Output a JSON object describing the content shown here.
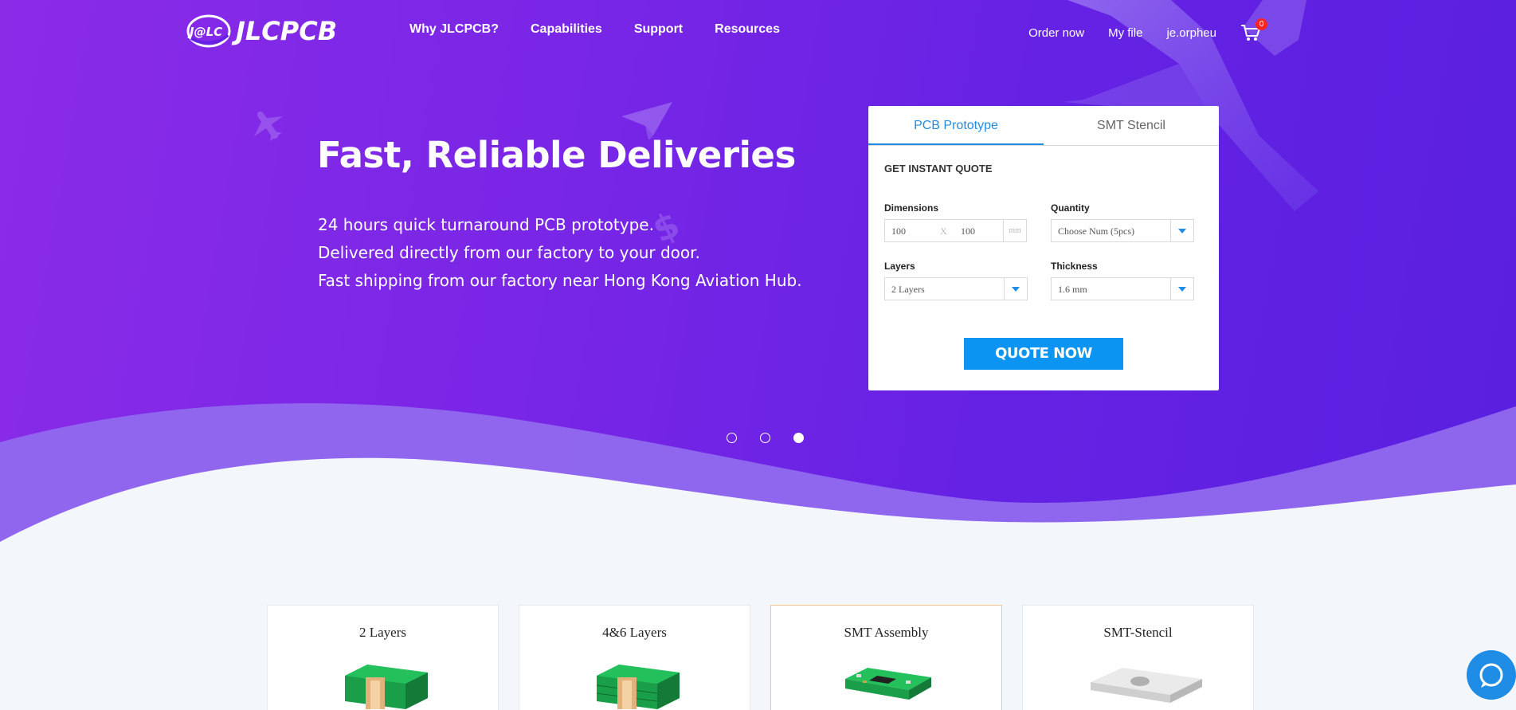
{
  "nav": {
    "brand": "JLCPCB",
    "brand_mark": "J@LC",
    "links": [
      "Why JLCPCB?",
      "Capabilities",
      "Support",
      "Resources"
    ],
    "order_now": "Order now",
    "my_file": "My file",
    "username": "je.orpheu",
    "cart_count": "0"
  },
  "hero": {
    "headline": "Fast, Reliable Deliveries",
    "lines": [
      "24 hours quick turnaround PCB prototype.",
      "Delivered directly from our factory to your door.",
      "Fast shipping from our factory near Hong Kong Aviation Hub."
    ],
    "carousel_active": 3,
    "carousel_count": 3
  },
  "quote": {
    "tabs": [
      "PCB Prototype",
      "SMT Stencil"
    ],
    "active_tab": 0,
    "title": "GET INSTANT QUOTE",
    "dimensions_label": "Dimensions",
    "dim_x": "100",
    "dim_sep": "X",
    "dim_y": "100",
    "dim_unit": "mm",
    "quantity_label": "Quantity",
    "quantity_value": "Choose Num (5pcs)",
    "layers_label": "Layers",
    "layers_value": "2 Layers",
    "thickness_label": "Thickness",
    "thickness_value": "1.6 mm",
    "button": "QUOTE NOW"
  },
  "products": [
    {
      "title": "2 Layers"
    },
    {
      "title": "4&6 Layers"
    },
    {
      "title": "SMT Assembly"
    },
    {
      "title": "SMT-Stencil"
    }
  ],
  "colors": {
    "accent": "#1f8ce6",
    "hero": "#6a24e4",
    "button": "#0c94f2",
    "badge": "#ff2424"
  }
}
